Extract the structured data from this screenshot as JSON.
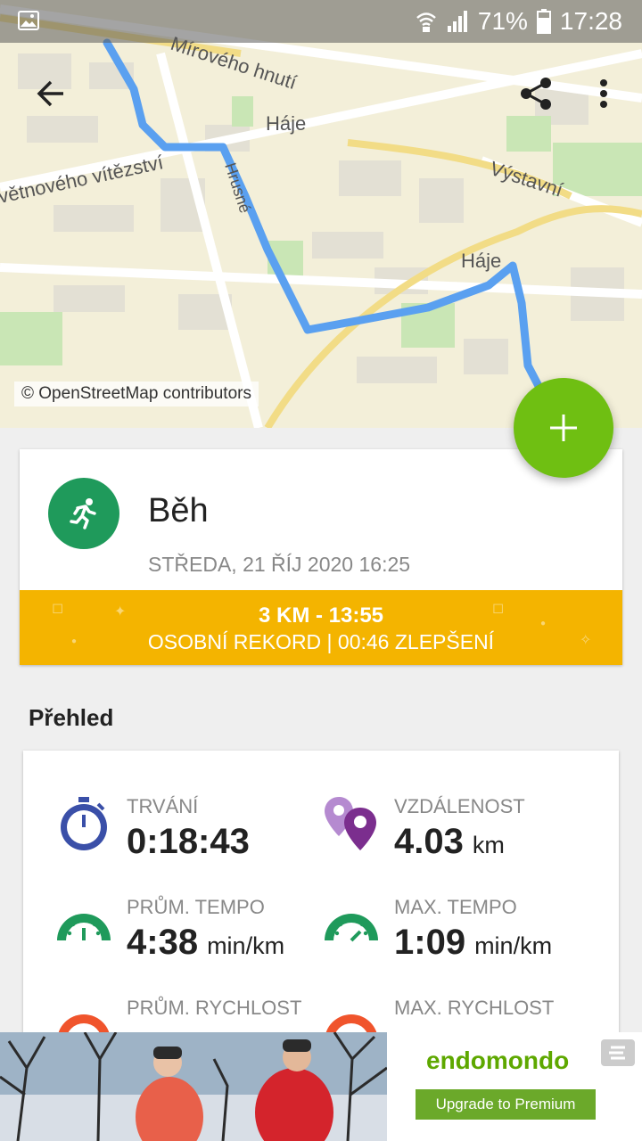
{
  "status_bar": {
    "battery": "71%",
    "time": "17:28"
  },
  "map": {
    "attribution": "© OpenStreetMap contributors",
    "labels": [
      "Mírového hnutí",
      "Háje",
      "větnového vítězství",
      "Výstavní",
      "Háje",
      "Hrusné"
    ],
    "route_color": "#5aa0f0"
  },
  "toolbar": {
    "back_icon": "arrow-left-icon",
    "share_icon": "share-icon",
    "more_icon": "more-vert-icon"
  },
  "fab": {
    "icon": "plus-icon",
    "color": "#6fbf12"
  },
  "activity": {
    "title": "Běh",
    "date": "STŘEDA, 21 ŘÍJ 2020 16:25",
    "icon": "running-icon",
    "icon_color": "#1f9a5b"
  },
  "record": {
    "line1": "3 KM  -  13:55",
    "line2": "OSOBNÍ REKORD  |  00:46 ZLEPŠENÍ",
    "color": "#f4b400"
  },
  "overview": {
    "title": "Přehled",
    "stats": [
      {
        "label": "TRVÁNÍ",
        "value": "0:18:43",
        "unit": "",
        "icon": "stopwatch-icon"
      },
      {
        "label": "VZDÁLENOST",
        "value": "4.03",
        "unit": "km",
        "icon": "map-pins-icon"
      },
      {
        "label": "PRŮM. TEMPO",
        "value": "4:38",
        "unit": "min/km",
        "icon": "speedometer-icon"
      },
      {
        "label": "MAX. TEMPO",
        "value": "1:09",
        "unit": "min/km",
        "icon": "speedometer-icon"
      },
      {
        "label": "PRŮM. RYCHLOST",
        "value": "",
        "unit": "",
        "icon": "speedometer-icon"
      },
      {
        "label": "MAX. RYCHLOST",
        "value": "",
        "unit": "",
        "icon": "speedometer-icon"
      }
    ]
  },
  "ad": {
    "brand": "endomondo",
    "button": "Upgrade to Premium"
  }
}
